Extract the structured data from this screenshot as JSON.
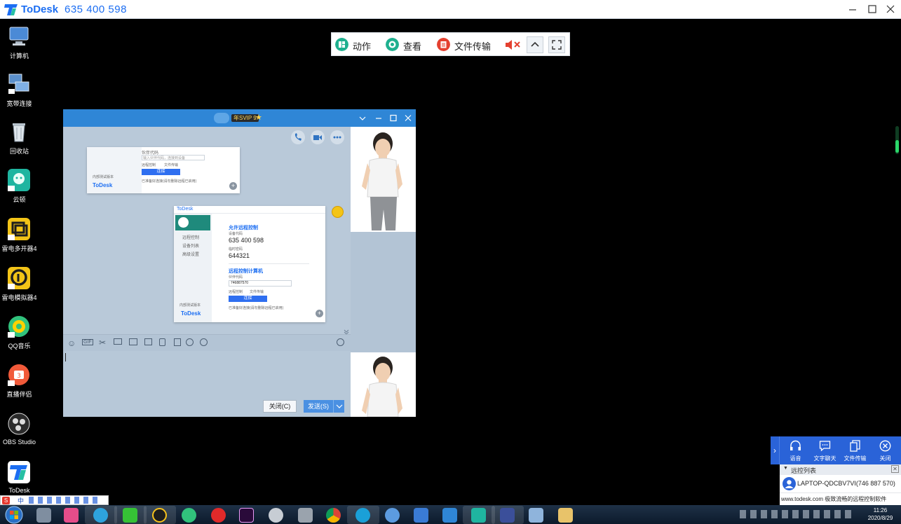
{
  "app": {
    "brand": "ToDesk",
    "device_id": "635 400 598"
  },
  "toolbar": {
    "action_label": "动作",
    "view_label": "查看",
    "file_label": "文件传输"
  },
  "desktop_icons": [
    {
      "label": "计算机",
      "icon": "computer-icon",
      "color": "#4b8ad6"
    },
    {
      "label": "宽带连接",
      "icon": "network-icon",
      "color": "#5b90cc"
    },
    {
      "label": "回收站",
      "icon": "recycle-bin-icon",
      "color": "#7d8a96"
    },
    {
      "label": "云顿",
      "icon": "cloud-icon",
      "color": "#1fb5a0"
    },
    {
      "label": "雷电多开器4",
      "icon": "multi-instance-icon",
      "color": "#f3c417"
    },
    {
      "label": "雷电模拟器4",
      "icon": "emulator-icon",
      "color": "#f3c417"
    },
    {
      "label": "QQ音乐",
      "icon": "qq-music-icon",
      "color": "#31c27c"
    },
    {
      "label": "直播伴侣",
      "icon": "live-companion-icon",
      "color": "#f15a3a"
    },
    {
      "label": "OBS Studio",
      "icon": "obs-icon",
      "color": "#2b2b2b"
    },
    {
      "label": "ToDesk",
      "icon": "todesk-icon",
      "color": "#ffffff"
    }
  ],
  "chat": {
    "vip_badge": "年SVIP 9",
    "close_button": "关闭(C)",
    "send_button": "发送(S)",
    "inner_window": {
      "brand": "ToDesk",
      "menu": [
        "远程控制",
        "设备列表",
        "高级设置"
      ],
      "allow_remote_title": "允许远程控制",
      "device_code_label": "设备代码",
      "device_code": "635 400 598",
      "temp_password_label": "临时密码",
      "temp_password": "644321",
      "remote_title": "远程控制计算机",
      "partner_label": "伙伴代码",
      "partner_value": "746887570",
      "opt_remote": "远程控制",
      "opt_file": "文件传输",
      "connect_button": "连接",
      "status": "已准备好连接(请勿删除远程已启用)",
      "edition": "内部测试版本"
    },
    "small_shot": {
      "partner_label": "伙伴代码",
      "partner_placeholder": "输入伙伴代码，连接到设备",
      "opt_remote": "远程控制",
      "opt_file": "文件传输",
      "connect_button": "连接",
      "status": "已准备好连接(请勿删除远程已启用)",
      "edition": "内部测试版本",
      "brand": "ToDesk"
    }
  },
  "remote_panel": {
    "buttons": [
      {
        "label": "语音",
        "icon": "headset-icon"
      },
      {
        "label": "文字聊天",
        "icon": "chat-icon"
      },
      {
        "label": "文件传输",
        "icon": "file-transfer-icon"
      },
      {
        "label": "关闭",
        "icon": "close-circle-icon"
      }
    ],
    "list_title": "远控列表",
    "device": "LAPTOP-QDCBV7VI(746 887 570)",
    "footer": "www.todesk.com 极致流畅的远程控制软件"
  },
  "clock": {
    "time": "11:26",
    "date": "2020/8/29"
  },
  "ime": {
    "text": "中"
  }
}
